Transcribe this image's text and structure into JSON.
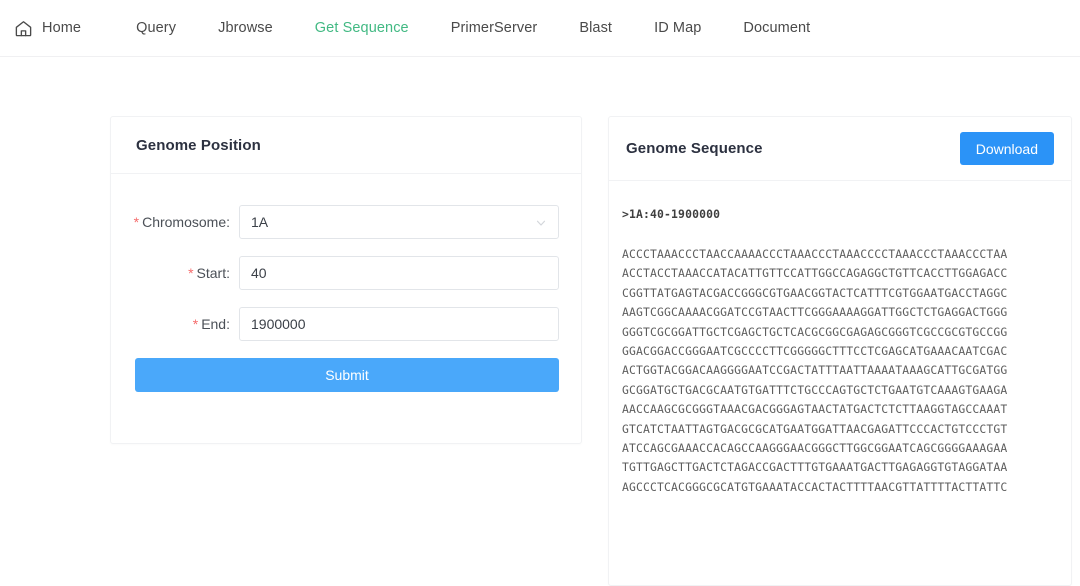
{
  "nav": {
    "home_icon": "home-icon",
    "items": [
      {
        "label": "Home",
        "active": false
      },
      {
        "label": "Query",
        "active": false
      },
      {
        "label": "Jbrowse",
        "active": false
      },
      {
        "label": "Get Sequence",
        "active": true
      },
      {
        "label": "PrimerServer",
        "active": false
      },
      {
        "label": "Blast",
        "active": false
      },
      {
        "label": "ID Map",
        "active": false
      },
      {
        "label": "Document",
        "active": false
      }
    ],
    "active_color": "#42b983"
  },
  "position_panel": {
    "title": "Genome Position",
    "required_marker": "*",
    "fields": {
      "chromosome": {
        "label": "Chromosome",
        "separator": ":",
        "value": "1A",
        "dropdown_icon": "chevron-down-icon"
      },
      "start": {
        "label": "Start",
        "separator": ":",
        "value": "40"
      },
      "end": {
        "label": "End",
        "separator": ":",
        "value": "1900000"
      }
    },
    "submit_label": "Submit",
    "submit_color": "#4aa8fa"
  },
  "sequence_panel": {
    "title": "Genome Sequence",
    "download_label": "Download",
    "download_color": "#2b93f7",
    "fasta_header": ">1A:40-1900000",
    "sequence_lines": [
      "ACCCTAAACCCTAACCAAAACCCTAAACCCTAAACCCCTAAACCCTAAACCCTAA",
      "ACCTACCTAAACCATACATTGTTCCATTGGCCAGAGGCTGTTCACCTTGGAGACC",
      "CGGTTATGAGTACGACCGGGCGTGAACGGTACTCATTTCGTGGAATGACCTAGGC",
      "AAGTCGGCAAAACGGATCCGTAACTTCGGGAAAAGGATTGGCTCTGAGGACTGGG",
      "GGGTCGCGGATTGCTCGAGCTGCTCACGCGGCGAGAGCGGGTCGCCGCGTGCCGG",
      "GGACGGACCGGGAATCGCCCCTTCGGGGGCTTTCCTCGAGCATGAAACAATCGAC",
      "ACTGGTACGGACAAGGGGAATCCGACTATTTAATTAAAATAAAGCATTGCGATGG",
      "GCGGATGCTGACGCAATGTGATTTCTGCCCAGTGCTCTGAATGTCAAAGTGAAGA",
      "AACCAAGCGCGGGTAAACGACGGGAGTAACTATGACTCTCTTAAGGTAGCCAAAT",
      "GTCATCTAATTAGTGACGCGCATGAATGGATTAACGAGATTCCCACTGTCCCTGT",
      "ATCCAGCGAAACCACAGCCAAGGGAACGGGCTTGGCGGAATCAGCGGGGAAAGAA",
      "TGTTGAGCTTGACTCTAGACCGACTTTGTGAAATGACTTGAGAGGTGTAGGATAA",
      "AGCCCTCACGGGCGCATGTGAAATACCACTACTTTTAACGTTATTTTACTTATTC"
    ]
  }
}
